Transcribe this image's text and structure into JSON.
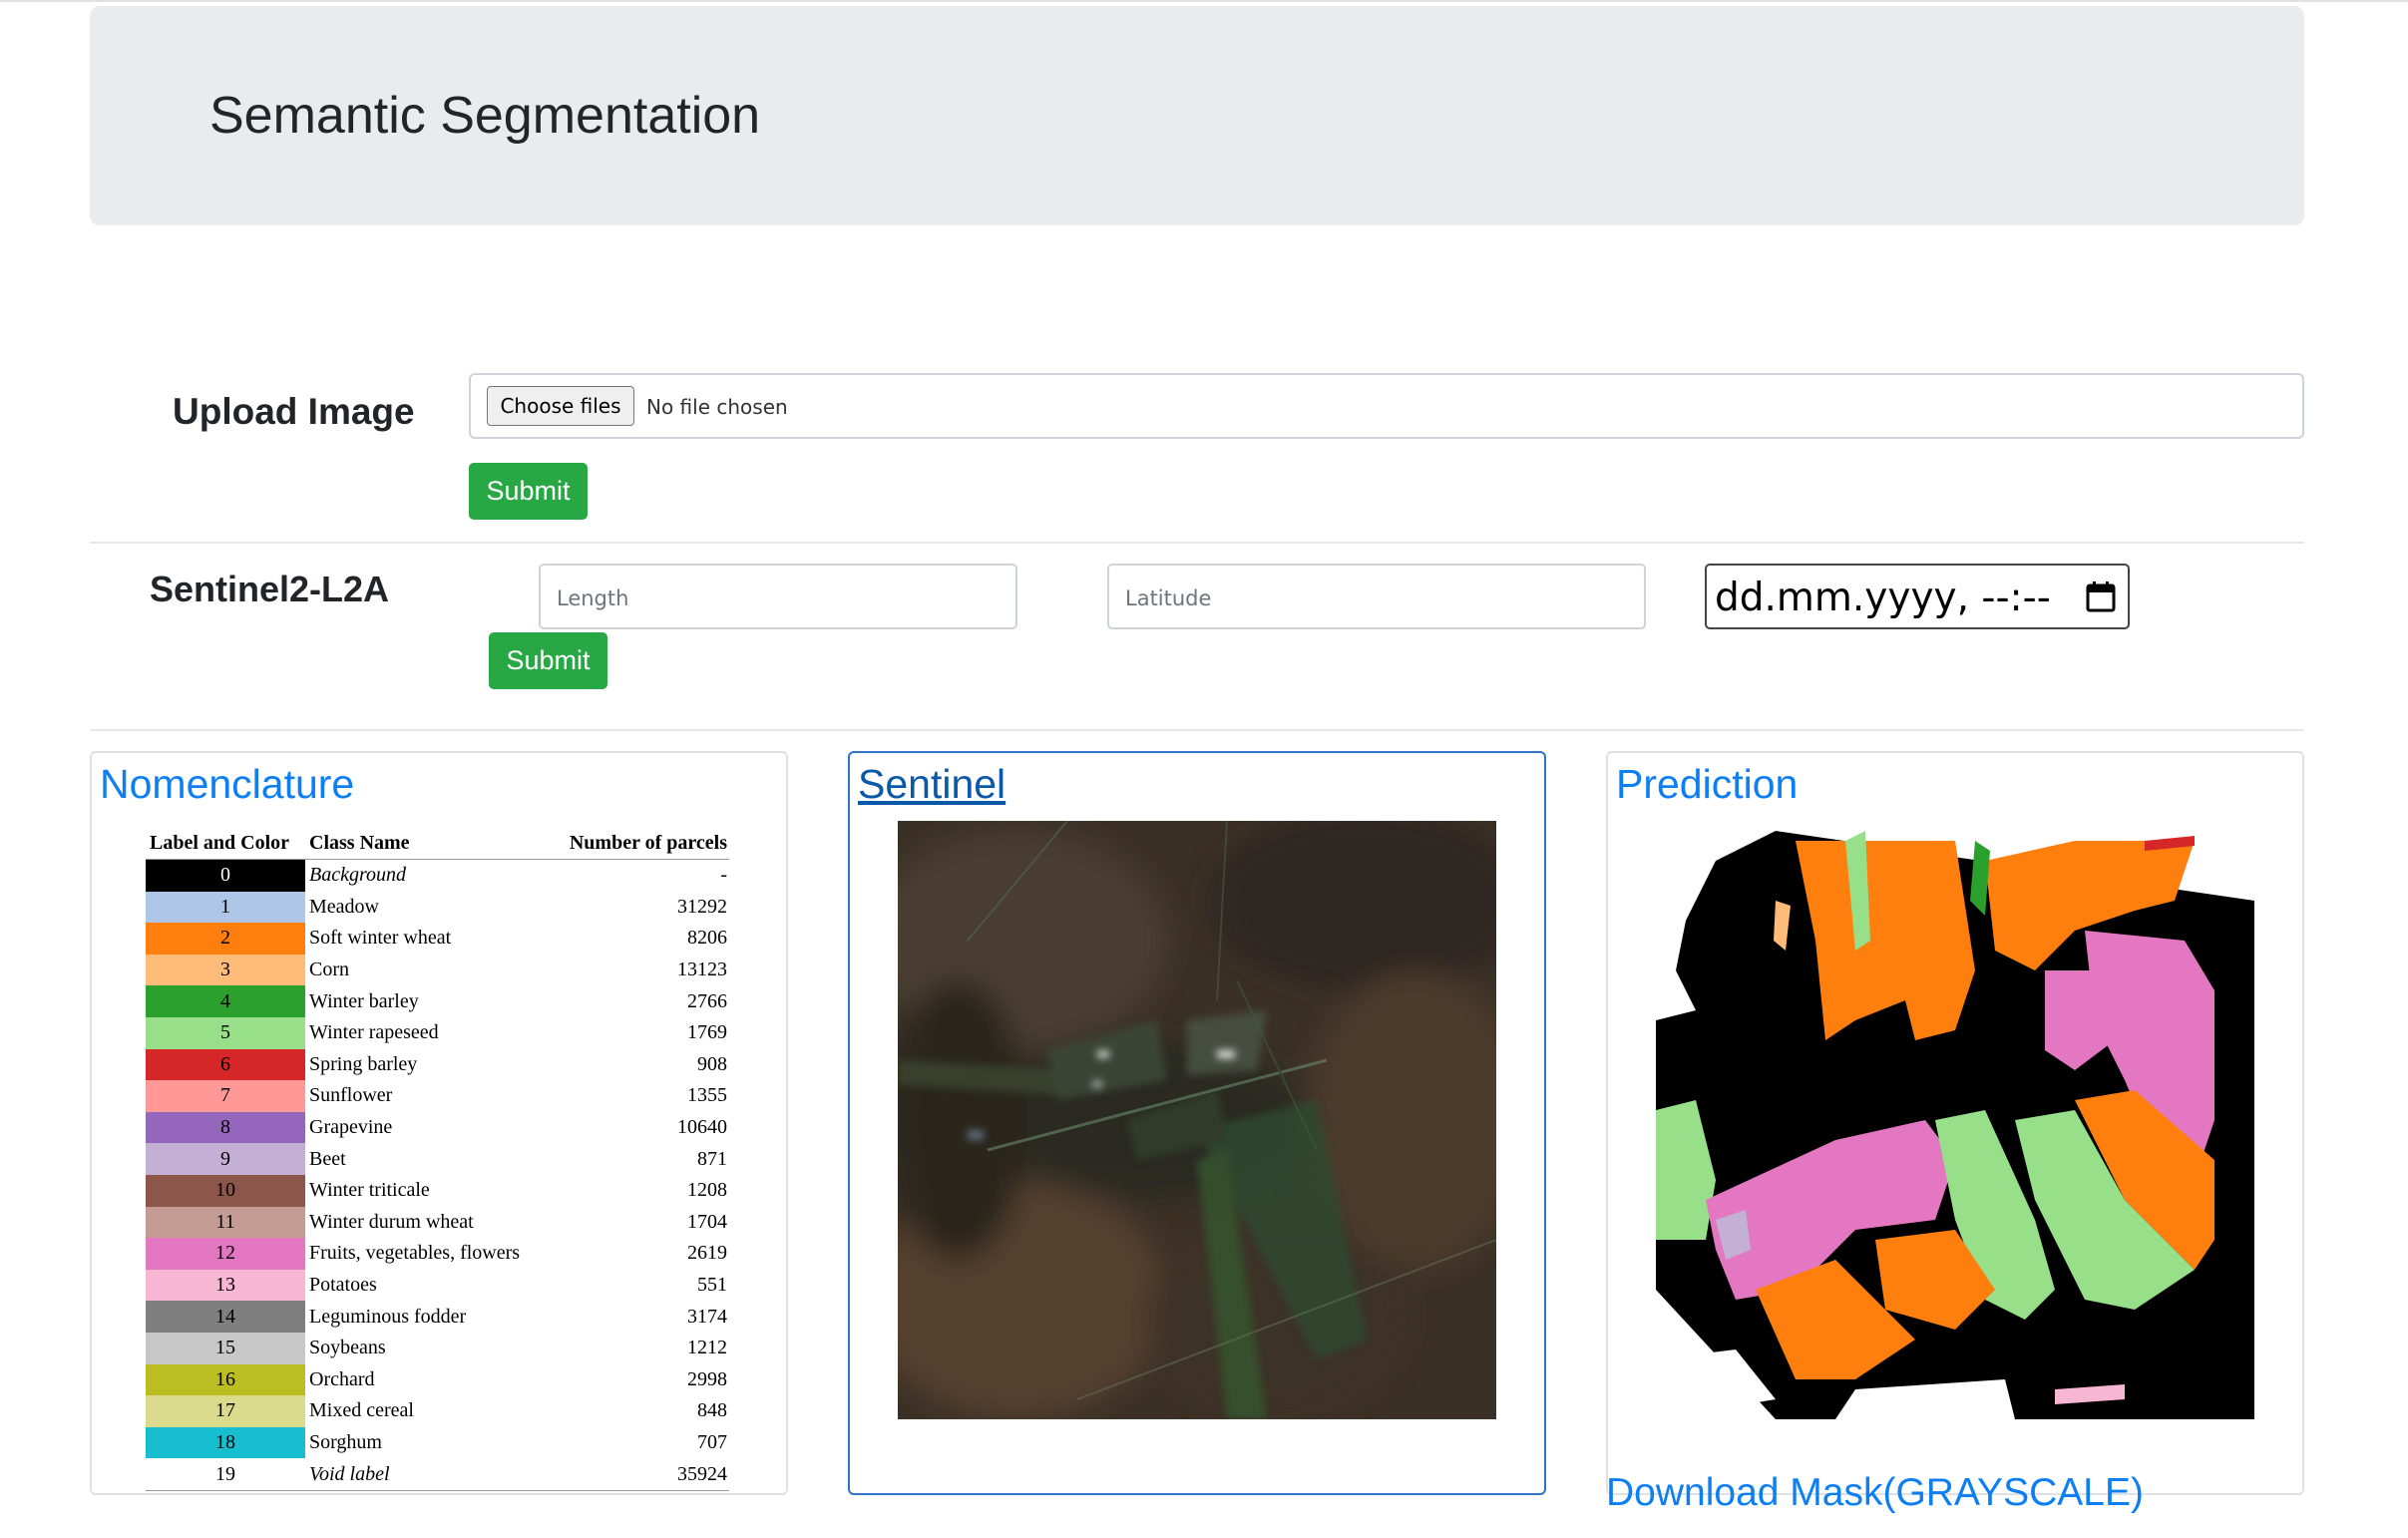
{
  "header": {
    "title": "Semantic Segmentation"
  },
  "upload": {
    "label": "Upload Image",
    "choose_button": "Choose files",
    "file_status": "No file chosen",
    "submit_label": "Submit"
  },
  "sentinel_form": {
    "label": "Sentinel2-L2A",
    "length_placeholder": "Length",
    "latitude_placeholder": "Latitude",
    "datetime_value": "dd.mm.yyyy, --:--",
    "submit_label": "Submit"
  },
  "nomenclature": {
    "title": "Nomenclature",
    "columns": [
      "Label and Color",
      "Class Name",
      "Number of parcels"
    ],
    "rows": [
      {
        "label": "0",
        "color": "#000000",
        "text_color": "#ffffff",
        "name": "Background",
        "count": "-",
        "italic": true
      },
      {
        "label": "1",
        "color": "#aec7e8",
        "text_color": "#000000",
        "name": "Meadow",
        "count": "31292"
      },
      {
        "label": "2",
        "color": "#ff7f0e",
        "text_color": "#000000",
        "name": "Soft winter wheat",
        "count": "8206"
      },
      {
        "label": "3",
        "color": "#ffbb78",
        "text_color": "#000000",
        "name": "Corn",
        "count": "13123"
      },
      {
        "label": "4",
        "color": "#2ca02c",
        "text_color": "#000000",
        "name": "Winter barley",
        "count": "2766"
      },
      {
        "label": "5",
        "color": "#98df8a",
        "text_color": "#000000",
        "name": "Winter rapeseed",
        "count": "1769"
      },
      {
        "label": "6",
        "color": "#d62728",
        "text_color": "#000000",
        "name": "Spring barley",
        "count": "908"
      },
      {
        "label": "7",
        "color": "#ff9896",
        "text_color": "#000000",
        "name": "Sunflower",
        "count": "1355"
      },
      {
        "label": "8",
        "color": "#9467bd",
        "text_color": "#000000",
        "name": "Grapevine",
        "count": "10640"
      },
      {
        "label": "9",
        "color": "#c5b0d5",
        "text_color": "#000000",
        "name": "Beet",
        "count": "871"
      },
      {
        "label": "10",
        "color": "#8c564b",
        "text_color": "#000000",
        "name": "Winter triticale",
        "count": "1208"
      },
      {
        "label": "11",
        "color": "#c49c94",
        "text_color": "#000000",
        "name": "Winter durum wheat",
        "count": "1704"
      },
      {
        "label": "12",
        "color": "#e377c2",
        "text_color": "#000000",
        "name": "Fruits,  vegetables, flowers",
        "count": "2619"
      },
      {
        "label": "13",
        "color": "#f7b6d2",
        "text_color": "#000000",
        "name": "Potatoes",
        "count": "551"
      },
      {
        "label": "14",
        "color": "#7f7f7f",
        "text_color": "#000000",
        "name": "Leguminous fodder",
        "count": "3174"
      },
      {
        "label": "15",
        "color": "#c7c7c7",
        "text_color": "#000000",
        "name": "Soybeans",
        "count": "1212"
      },
      {
        "label": "16",
        "color": "#bcbd22",
        "text_color": "#000000",
        "name": "Orchard",
        "count": "2998"
      },
      {
        "label": "17",
        "color": "#dbdb8d",
        "text_color": "#000000",
        "name": "Mixed cereal",
        "count": "848"
      },
      {
        "label": "18",
        "color": "#17becf",
        "text_color": "#000000",
        "name": "Sorghum",
        "count": "707"
      },
      {
        "label": "19",
        "color": "#ffffff",
        "text_color": "#000000",
        "name": "Void label",
        "count": "35924",
        "italic": true
      }
    ]
  },
  "sentinel_card": {
    "title": "Sentinel"
  },
  "prediction_card": {
    "title": "Prediction"
  },
  "download": {
    "label": "Download Mask(GRAYSCALE)"
  },
  "colors": {
    "accent": "#0d7ff2",
    "success": "#28a745",
    "jumbotron": "#e9ecef"
  }
}
